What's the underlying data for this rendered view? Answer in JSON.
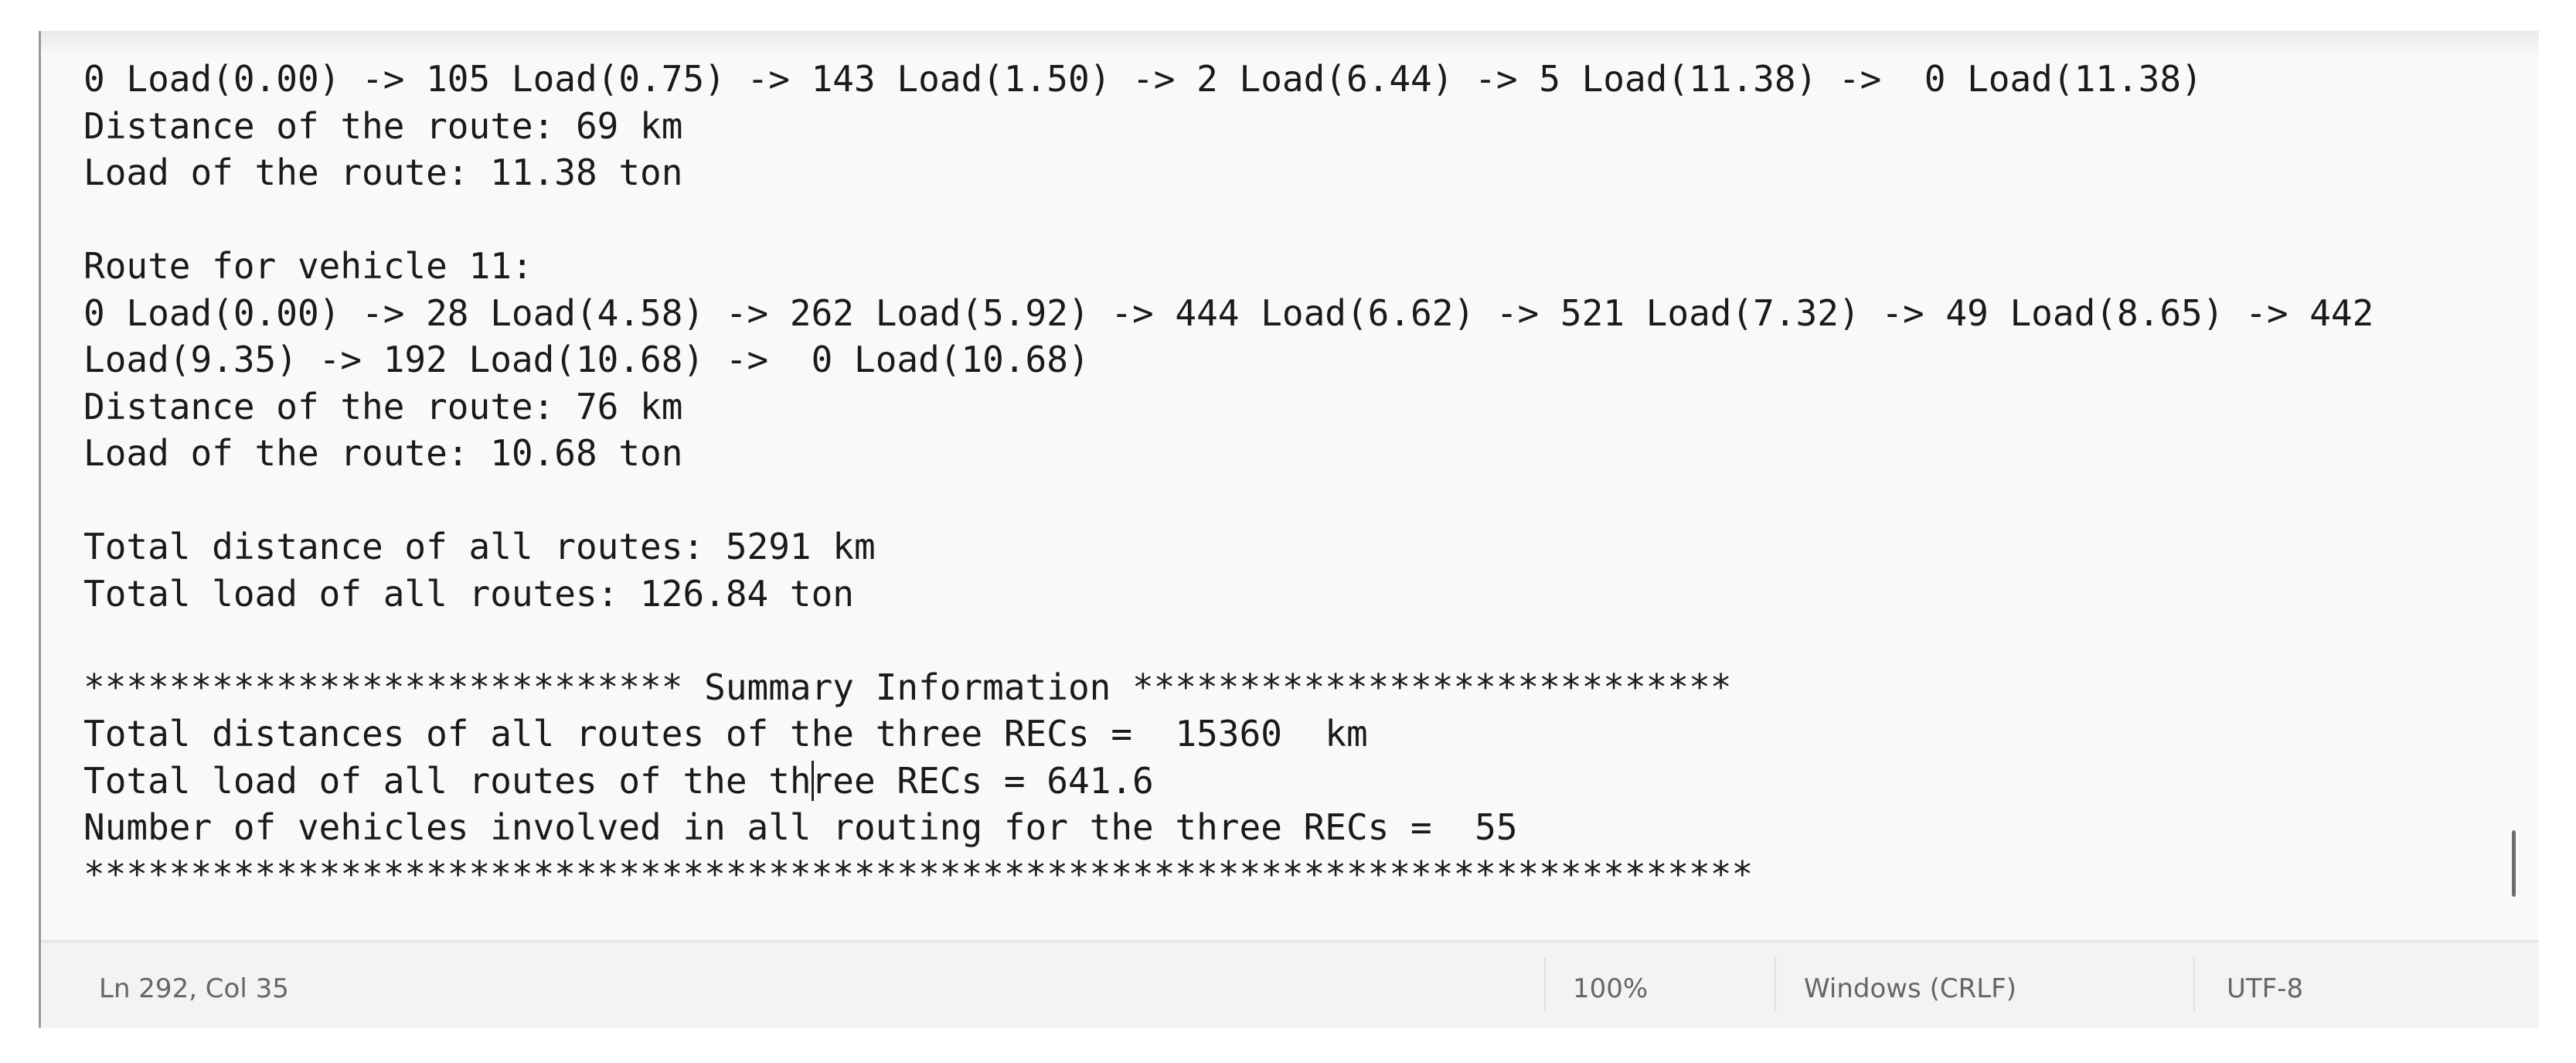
{
  "editor": {
    "lines": [
      "0 Load(0.00) -> 105 Load(0.75) -> 143 Load(1.50) -> 2 Load(6.44) -> 5 Load(11.38) ->  0 Load(11.38)",
      "Distance of the route: 69 km",
      "Load of the route: 11.38 ton",
      "",
      "Route for vehicle 11:",
      "0 Load(0.00) -> 28 Load(4.58) -> 262 Load(5.92) -> 444 Load(6.62) -> 521 Load(7.32) -> 49 Load(8.65) -> 442",
      "Load(9.35) -> 192 Load(10.68) ->  0 Load(10.68)",
      "Distance of the route: 76 km",
      "Load of the route: 10.68 ton",
      "",
      "Total distance of all routes: 5291 km",
      "Total load of all routes: 126.84 ton",
      "",
      "**************************** Summary Information ****************************",
      "Total distances of all routes of the three RECs =  15360  km",
      "Total load of all routes of the three RECs = 641.6",
      "Number of vehicles involved in all routing for the three RECs =  55",
      "******************************************************************************"
    ]
  },
  "statusbar": {
    "position": "Ln 292, Col 35",
    "zoom": "100%",
    "line_ending": "Windows (CRLF)",
    "encoding": "UTF-8"
  }
}
